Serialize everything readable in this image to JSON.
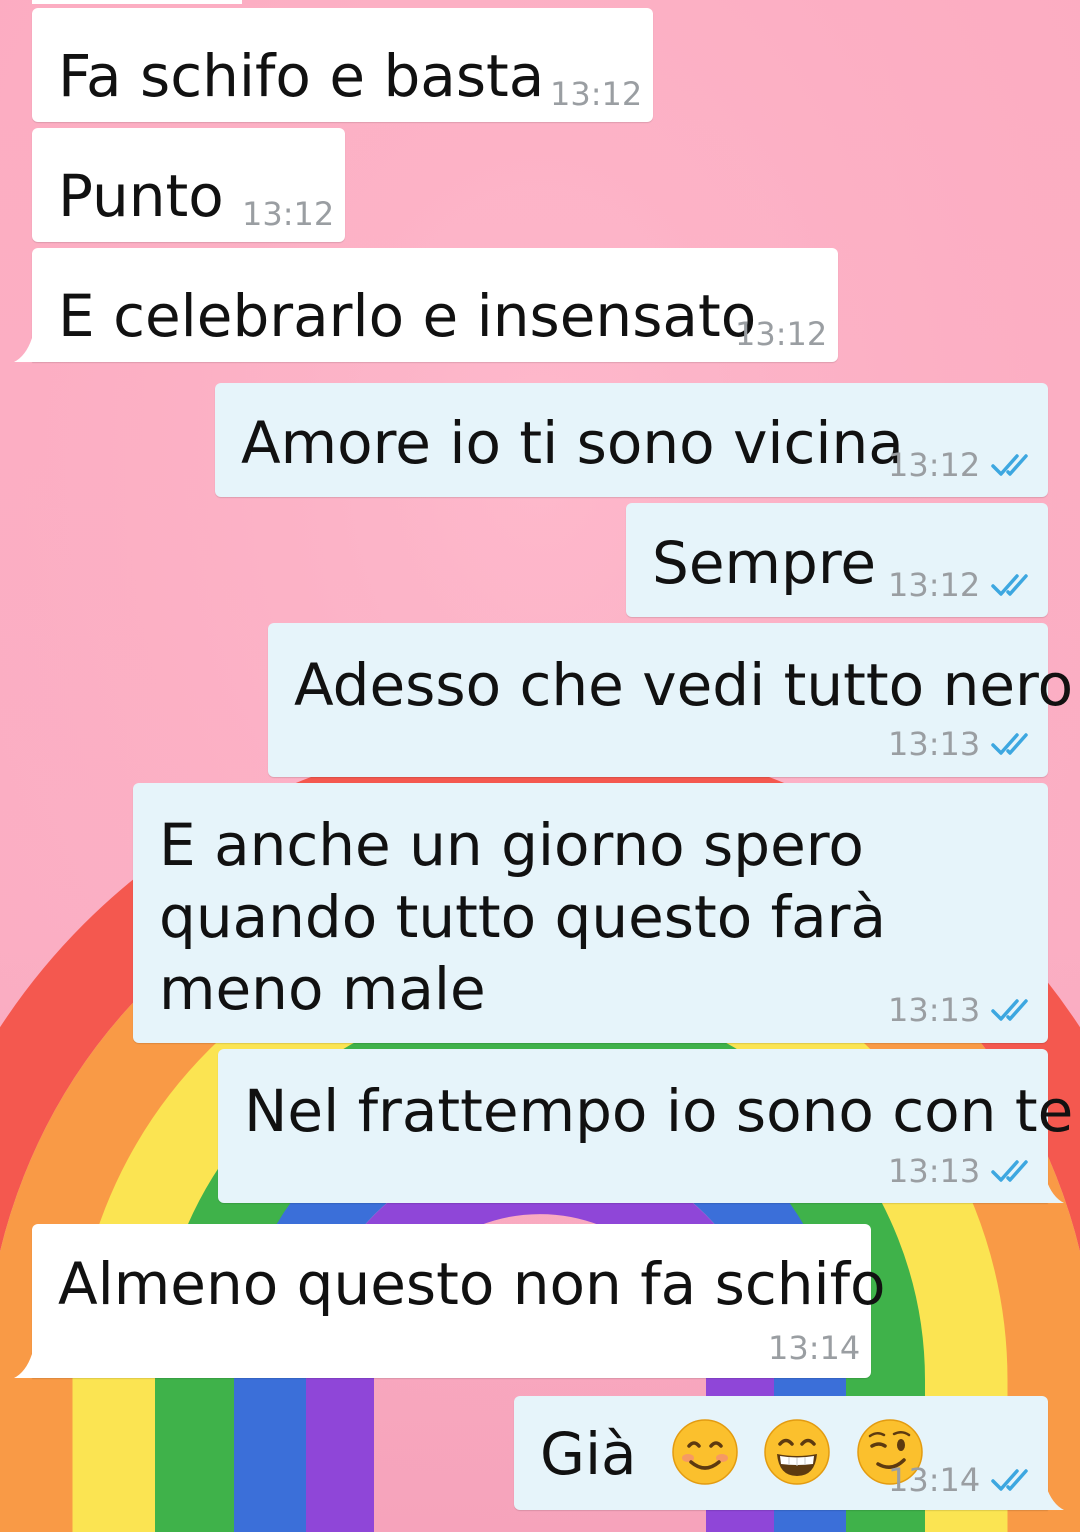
{
  "colors": {
    "wallpaper": "#fcacc1",
    "incoming_bubble": "#ffffff",
    "outgoing_bubble": "#e6f4fa",
    "tick_blue": "#3da7e0",
    "time_gray": "#9a9ea2"
  },
  "messages": [
    {
      "direction": "in",
      "text": "Fa schifo e basta",
      "time": "13:12"
    },
    {
      "direction": "in",
      "text": "Punto",
      "time": "13:12"
    },
    {
      "direction": "in",
      "text": "E celebrarlo e insensato",
      "time": "13:12"
    },
    {
      "direction": "out",
      "text": "Amore io ti sono vicina",
      "time": "13:12",
      "status": "read-double-tick-icon"
    },
    {
      "direction": "out",
      "text": "Sempre",
      "time": "13:12",
      "status": "read-double-tick-icon"
    },
    {
      "direction": "out",
      "text": "Adesso che vedi tutto nero",
      "time": "13:13",
      "status": "read-double-tick-icon"
    },
    {
      "direction": "out",
      "text": "E anche un giorno spero quando tutto questo farà meno male",
      "time": "13:13",
      "status": "read-double-tick-icon"
    },
    {
      "direction": "out",
      "text": "Nel frattempo io sono con te",
      "time": "13:13",
      "status": "read-double-tick-icon"
    },
    {
      "direction": "in",
      "text": "Almeno questo non fa schifo",
      "time": "13:14"
    },
    {
      "direction": "out",
      "text": "Già",
      "time": "13:14",
      "status": "read-double-tick-icon",
      "emojis": [
        "smiling-face-icon",
        "grinning-face-icon",
        "winking-face-icon"
      ]
    }
  ]
}
